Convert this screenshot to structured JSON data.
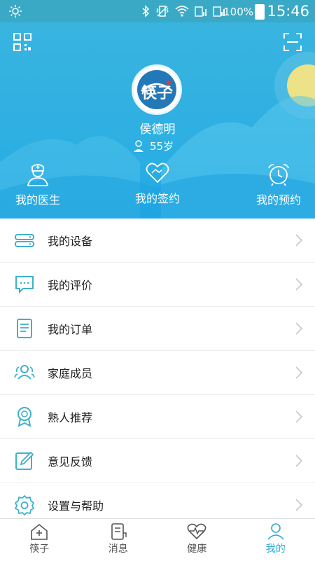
{
  "status_bar": {
    "battery_percent": "100%",
    "time": "15:46"
  },
  "profile": {
    "logo_text": "筷子",
    "name": "侯德明",
    "age": "55岁"
  },
  "shortcuts": [
    {
      "label": "我的医生",
      "icon": "doctor-icon"
    },
    {
      "label": "我的签约",
      "icon": "handshake-icon"
    },
    {
      "label": "我的预约",
      "icon": "alarm-clock-icon"
    }
  ],
  "menu": [
    {
      "label": "我的设备",
      "icon": "device-icon"
    },
    {
      "label": "我的评价",
      "icon": "chat-bubble-icon"
    },
    {
      "label": "我的订单",
      "icon": "order-list-icon"
    },
    {
      "label": "家庭成员",
      "icon": "family-icon"
    },
    {
      "label": "熟人推荐",
      "icon": "award-ribbon-icon"
    },
    {
      "label": "意见反馈",
      "icon": "edit-feedback-icon"
    },
    {
      "label": "设置与帮助",
      "icon": "settings-gear-icon"
    }
  ],
  "tabs": [
    {
      "label": "筷子",
      "icon": "home-plus-icon",
      "active": false
    },
    {
      "label": "消息",
      "icon": "message-icon",
      "active": false
    },
    {
      "label": "健康",
      "icon": "heart-pulse-icon",
      "active": false
    },
    {
      "label": "我的",
      "icon": "person-icon",
      "active": true
    }
  ],
  "colors": {
    "accent": "#2da6d8",
    "header": "#2fb0e2",
    "icon": "#3fb1c9"
  }
}
